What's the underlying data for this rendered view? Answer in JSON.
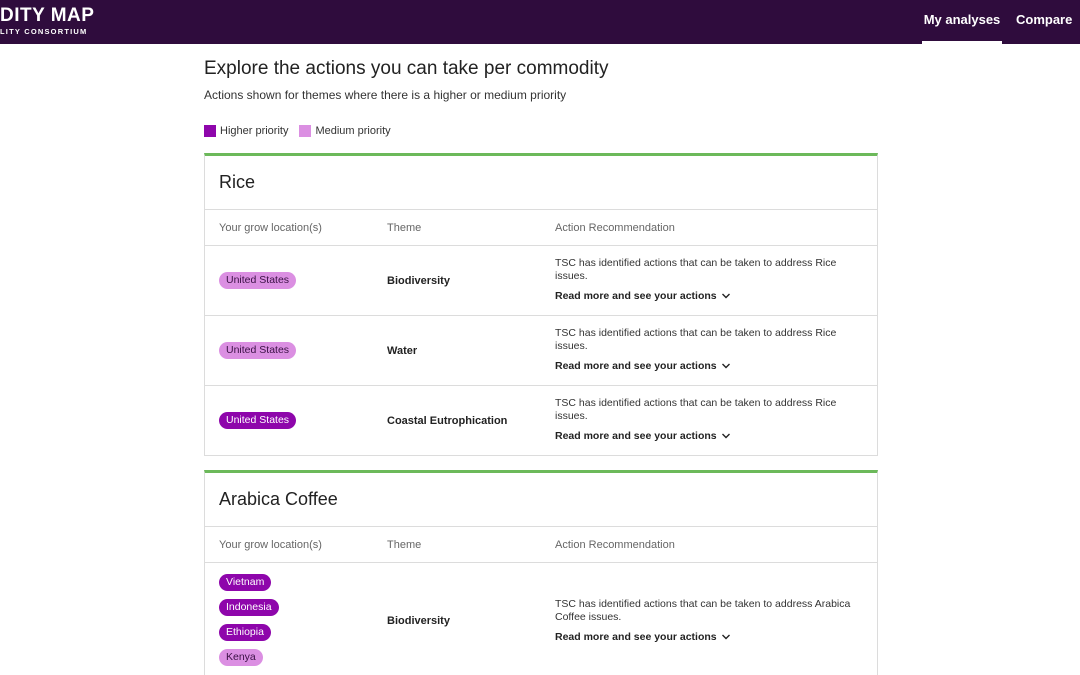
{
  "header": {
    "logo_main": "DITY MAP",
    "logo_sub": "LITY CONSORTIUM",
    "nav": [
      {
        "label": "My analyses",
        "active": true
      },
      {
        "label": "Compare",
        "active": false
      }
    ]
  },
  "page": {
    "title": "Explore the actions you can take per commodity",
    "subtitle": "Actions shown for themes where there is a higher or medium priority"
  },
  "legend": {
    "higher": {
      "label": "Higher priority",
      "color": "#8e06ab"
    },
    "medium": {
      "label": "Medium priority",
      "color": "#db8fe2"
    }
  },
  "columns": {
    "location": "Your grow location(s)",
    "theme": "Theme",
    "action": "Action Recommendation"
  },
  "read_more_label": "Read more and see your actions",
  "commodities": [
    {
      "name": "Rice",
      "rows": [
        {
          "locations": [
            {
              "name": "United States",
              "priority": "medium"
            }
          ],
          "theme": "Biodiversity",
          "action": "TSC has identified actions that can be taken to address Rice issues."
        },
        {
          "locations": [
            {
              "name": "United States",
              "priority": "medium"
            }
          ],
          "theme": "Water",
          "action": "TSC has identified actions that can be taken to address Rice issues."
        },
        {
          "locations": [
            {
              "name": "United States",
              "priority": "higher"
            }
          ],
          "theme": "Coastal Eutrophication",
          "action": "TSC has identified actions that can be taken to address Rice issues."
        }
      ]
    },
    {
      "name": "Arabica Coffee",
      "rows": [
        {
          "locations": [
            {
              "name": "Vietnam",
              "priority": "higher"
            },
            {
              "name": "Indonesia",
              "priority": "higher"
            },
            {
              "name": "Ethiopia",
              "priority": "higher"
            },
            {
              "name": "Kenya",
              "priority": "medium"
            }
          ],
          "theme": "Biodiversity",
          "action": "TSC has identified actions that can be taken to address Arabica Coffee issues."
        }
      ]
    }
  ]
}
